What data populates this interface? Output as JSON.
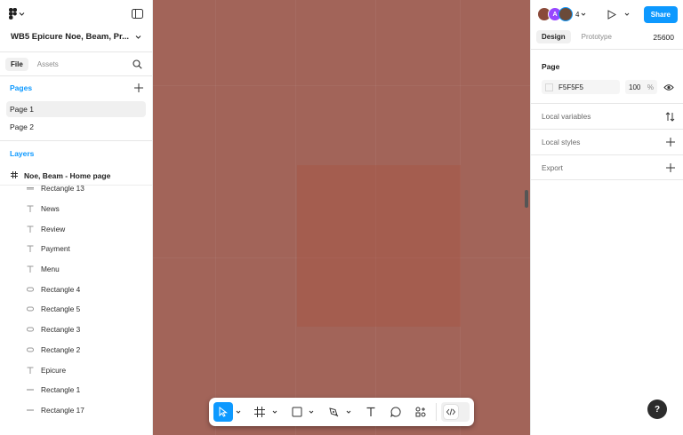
{
  "app": {
    "file_title": "WB5 Epicure Noe, Beam, Pr...",
    "logo_icon": "figma-logo-icon"
  },
  "left": {
    "tabs": [
      "File",
      "Assets"
    ],
    "pages_title": "Pages",
    "pages": [
      "Page 1",
      "Page 2"
    ],
    "layers_title": "Layers",
    "frame_name": "Noe, Beam - Home page",
    "layers": [
      {
        "name": "Rectangle 13",
        "icon": "rectangle-icon"
      },
      {
        "name": "News",
        "icon": "text-icon"
      },
      {
        "name": "Review",
        "icon": "text-icon"
      },
      {
        "name": "Payment",
        "icon": "text-icon"
      },
      {
        "name": "Menu",
        "icon": "text-icon"
      },
      {
        "name": "Rectangle 4",
        "icon": "ellipse-icon"
      },
      {
        "name": "Rectangle 5",
        "icon": "ellipse-icon"
      },
      {
        "name": "Rectangle 3",
        "icon": "ellipse-icon"
      },
      {
        "name": "Rectangle 2",
        "icon": "ellipse-icon"
      },
      {
        "name": "Epicure",
        "icon": "text-icon"
      },
      {
        "name": "Rectangle 1",
        "icon": "line-icon"
      },
      {
        "name": "Rectangle 17",
        "icon": "line-icon"
      }
    ]
  },
  "right": {
    "avatar_letter": "A",
    "collaborator_count": "4",
    "share_label": "Share",
    "tabs": [
      "Design",
      "Prototype"
    ],
    "zoom": "25600",
    "page_title": "Page",
    "bg_color_hex": "F5F5F5",
    "bg_opacity": "100",
    "pct": "%",
    "local_variables": "Local variables",
    "local_styles": "Local styles",
    "export": "Export",
    "help": "?"
  },
  "colors": {
    "accent": "#0d99ff",
    "canvas": "#a26459"
  }
}
